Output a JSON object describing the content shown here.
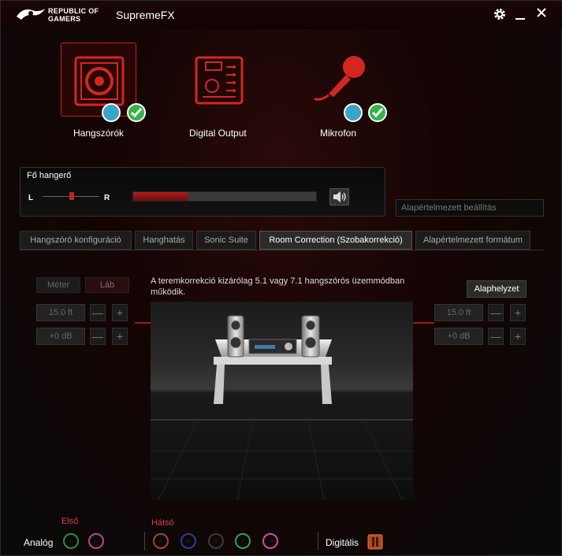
{
  "titlebar": {
    "brand_line1": "REPUBLIC OF",
    "brand_line2": "GAMERS",
    "app_title": "SupremeFX",
    "icons": [
      "rog-logo-icon",
      "gear-icon",
      "minimize-icon",
      "close-icon"
    ]
  },
  "devices": [
    {
      "label": "Hangszórók",
      "icon": "speaker-icon",
      "selected": true,
      "badges": [
        "chat-icon",
        "check-icon"
      ]
    },
    {
      "label": "Digital Output",
      "icon": "circuit-board-icon",
      "selected": false,
      "badges": []
    },
    {
      "label": "Mikrofon",
      "icon": "microphone-icon",
      "selected": false,
      "badges": [
        "chat-icon",
        "check-icon"
      ]
    }
  ],
  "volume": {
    "title": "Fő hangerő",
    "left_label": "L",
    "right_label": "R",
    "master_level_fraction": 0.3,
    "balance_fraction": 0.5
  },
  "preset": {
    "placeholder": "Alapértelmezett beállítás"
  },
  "tabs": [
    {
      "label": "Hangszóró konfiguráció",
      "active": false
    },
    {
      "label": "Hanghatás",
      "active": false
    },
    {
      "label": "Sonic Suite",
      "active": false
    },
    {
      "label": "Room Correction (Szobakorrekció)",
      "active": true
    },
    {
      "label": "Alapértelmezett formátum",
      "active": false
    }
  ],
  "room_correction": {
    "unit_meter": "Méter",
    "unit_foot": "Láb",
    "info_text": "A teremkorrekció kizárólag 5.1 vagy 7.1 hangszórós üzemmódban működik.",
    "reset_label": "Alaphelyzet",
    "left_distance": "15.0 ft",
    "left_gain": "+0 dB",
    "right_distance": "15.0 ft",
    "right_gain": "+0 dB",
    "minus": "—",
    "plus": "+"
  },
  "footer": {
    "front_label": "Első",
    "rear_label": "Hátsó",
    "analog_label": "Analóg",
    "digital_label": "Digitális",
    "jack_colors": {
      "front_green": "#2e8b3a",
      "front_pink": "#b0498f",
      "rear_orange": "#9a4a24",
      "rear_blue": "#24418f",
      "rear_black": "#3a3a3a",
      "rear_green": "#2fa24a",
      "rear_pink": "#d24aa8"
    }
  },
  "colors": {
    "accent": "#c0221f",
    "check": "#35b34a",
    "chat": "#3aa6c6"
  }
}
